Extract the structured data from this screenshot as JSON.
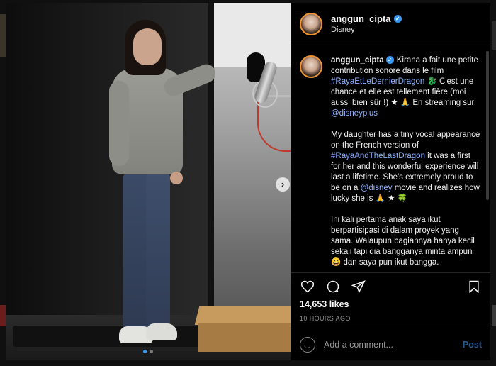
{
  "header": {
    "username": "anggun_cipta",
    "location": "Disney",
    "verified": true
  },
  "caption": {
    "username": "anggun_cipta",
    "paragraphs": [
      [
        {
          "t": "text",
          "v": "Kirana a fait une petite contribution sonore dans le film "
        },
        {
          "t": "tag",
          "v": "#RayaEtLeDernierDragon"
        },
        {
          "t": "text",
          "v": " 🐉 C'est une chance et elle est tellement fière (moi aussi bien sûr !) ★ 🙏 En streaming sur "
        },
        {
          "t": "tag",
          "v": "@disneyplus"
        }
      ],
      [
        {
          "t": "text",
          "v": "My daughter has a tiny vocal appearance on the French version of "
        },
        {
          "t": "tag",
          "v": "#RayaAndTheLastDragon"
        },
        {
          "t": "text",
          "v": " it was a first for her and this wonderful experience will last a lifetime. She's extremely proud to be on a "
        },
        {
          "t": "tag",
          "v": "@disney"
        },
        {
          "t": "text",
          "v": " movie and realizes how lucky she is 🙏 ★ 🍀"
        }
      ],
      [
        {
          "t": "text",
          "v": "Ini kali pertama anak saya ikut berpartisipasi di dalam proyek yang sama. Walaupun bagiannya hanya kecil sekali tapi dia bangganya minta ampun 😄 dan saya pun ikut bangga."
        }
      ]
    ]
  },
  "likes": "14,653 likes",
  "timestamp": "10 HOURS AGO",
  "comment": {
    "placeholder": "Add a comment...",
    "post_label": "Post"
  },
  "carousel": {
    "slides": 2,
    "active_index": 0
  },
  "icons": {
    "close": "close-icon",
    "next": "chevron-right-icon",
    "like": "heart-icon",
    "comment": "comment-icon",
    "share": "paper-plane-icon",
    "save": "bookmark-icon",
    "emoji": "emoji-icon"
  },
  "colors": {
    "accent": "#3897f0",
    "hashtag": "#8fb3ff",
    "post_disabled": "#2f5c8f"
  }
}
